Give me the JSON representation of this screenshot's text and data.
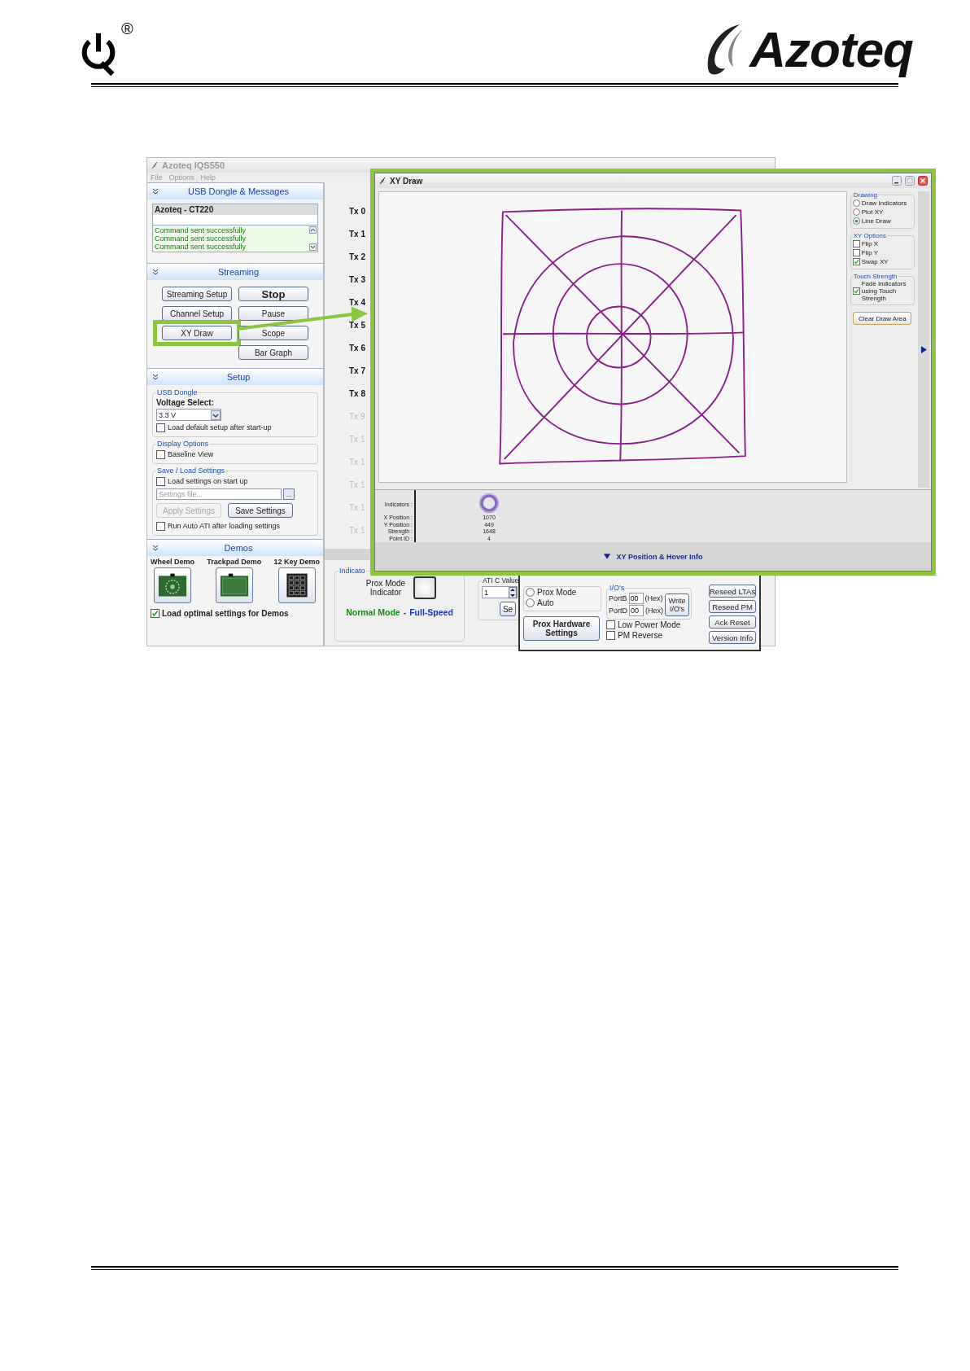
{
  "header": {
    "registered_mark": "®",
    "logo_text": "Azoteq"
  },
  "main_window": {
    "title": "Azoteq IQS550",
    "menu": [
      "File",
      "Options",
      "Help"
    ]
  },
  "usb_panel": {
    "header": "USB Dongle & Messages",
    "device": "Azoteq - CT220",
    "messages": [
      "Command sent successfully",
      "Command sent successfully",
      "Command sent successfully"
    ]
  },
  "streaming_panel": {
    "header": "Streaming",
    "left_buttons": [
      {
        "label": "Streaming Setup",
        "highlighted": false
      },
      {
        "label": "Channel Setup",
        "highlighted": false
      },
      {
        "label": "XY Draw",
        "highlighted": true
      }
    ],
    "right_buttons": [
      {
        "label": "Stop",
        "kind": "large"
      },
      {
        "label": "Pause",
        "kind": "normal"
      },
      {
        "label": "Scope",
        "kind": "normal"
      },
      {
        "label": "Bar Graph",
        "kind": "normal"
      }
    ]
  },
  "setup_panel": {
    "header": "Setup",
    "usb_group": {
      "title": "USB Dongle",
      "voltage_label": "Voltage Select:",
      "voltage": "3.3 V",
      "load_default": {
        "label": "Load default setup after start-up",
        "checked": false
      }
    },
    "display_group": {
      "title": "Display Options",
      "baseline": {
        "label": "Baseline View",
        "checked": false
      }
    },
    "save_group": {
      "title": "Save / Load Settings",
      "load_on_start": {
        "label": "Load settings on start up",
        "checked": false
      },
      "file_placeholder": "Settings file...",
      "browse": "...",
      "apply": {
        "label": "Apply Settings",
        "disabled": true
      },
      "save": {
        "label": "Save Settings",
        "disabled": false
      },
      "auto_ati": {
        "label": "Run Auto ATI after loading settings",
        "checked": false
      }
    }
  },
  "demos_panel": {
    "header": "Demos",
    "demos": [
      {
        "label": "Wheel Demo",
        "kind": "wheel"
      },
      {
        "label": "Trackpad Demo",
        "kind": "trackpad"
      },
      {
        "label": "12 Key Demo",
        "kind": "keypad"
      }
    ],
    "load_optimal": {
      "label": "Load optimal settings for Demos",
      "checked": true
    }
  },
  "channels": [
    {
      "label": "Tx 0",
      "disabled": false
    },
    {
      "label": "Tx 1",
      "disabled": false
    },
    {
      "label": "Tx 2",
      "disabled": false
    },
    {
      "label": "Tx 3",
      "disabled": false
    },
    {
      "label": "Tx 4",
      "disabled": false
    },
    {
      "label": "Tx 5",
      "disabled": false
    },
    {
      "label": "Tx 6",
      "disabled": false
    },
    {
      "label": "Tx 7",
      "disabled": false
    },
    {
      "label": "Tx 8",
      "disabled": false
    },
    {
      "label": "Tx 9",
      "disabled": true
    },
    {
      "label": "Tx 1",
      "disabled": true
    },
    {
      "label": "Tx 1",
      "disabled": true
    },
    {
      "label": "Tx 1",
      "disabled": true
    },
    {
      "label": "Tx 1",
      "disabled": true
    },
    {
      "label": "Tx 1",
      "disabled": true
    }
  ],
  "indicator_group": {
    "title": "Indicato",
    "prox_label": "Prox Mode Indicator",
    "mode": "Normal Mode",
    "separator": "-",
    "speed": "Full-Speed"
  },
  "ati_group": {
    "title": "ATI C Value",
    "value": "1",
    "button": "Se"
  },
  "hardware_panel": {
    "modes": [
      {
        "label": "Prox Mode",
        "selected": false
      },
      {
        "label": "Auto",
        "selected": false
      }
    ],
    "prox_hw_button": "Prox Hardware Settings",
    "io_group": {
      "title": "I/O's",
      "ports": [
        {
          "label": "PortB",
          "value": "00",
          "unit": "(Hex)"
        },
        {
          "label": "PortD",
          "value": "00",
          "unit": "(Hex)"
        }
      ],
      "write_button": "Write I/O's"
    },
    "options": [
      {
        "label": "Low Power Mode",
        "checked": false
      },
      {
        "label": "PM Reverse",
        "checked": false
      }
    ],
    "buttons": [
      "Reseed LTAs",
      "Reseed PM",
      "Ack Reset",
      "Version Info"
    ]
  },
  "xy_window": {
    "title": "XY Draw",
    "drawing_group": {
      "title": "Drawing",
      "options": [
        {
          "label": "Draw Indicators",
          "selected": false
        },
        {
          "label": "Plot XY",
          "selected": false
        },
        {
          "label": "Line Draw",
          "selected": true
        }
      ]
    },
    "xy_options": {
      "title": "XY Options",
      "options": [
        {
          "label": "Flip X",
          "checked": false
        },
        {
          "label": "Flip Y",
          "checked": false
        },
        {
          "label": "Swap XY",
          "checked": true
        }
      ]
    },
    "touch_strength": {
      "title": "Touch Strength",
      "option": {
        "label": "Fade indicators using Touch Strength",
        "checked": true
      }
    },
    "clear_button": "Clear Draw Area",
    "info_labels": [
      "Indicators :",
      "X Position :",
      "Y Position :",
      "Strength :",
      "Point ID :"
    ],
    "info_values": [
      "1070",
      "449",
      "1648",
      "4"
    ],
    "footer": "XY Position & Hover Info"
  }
}
